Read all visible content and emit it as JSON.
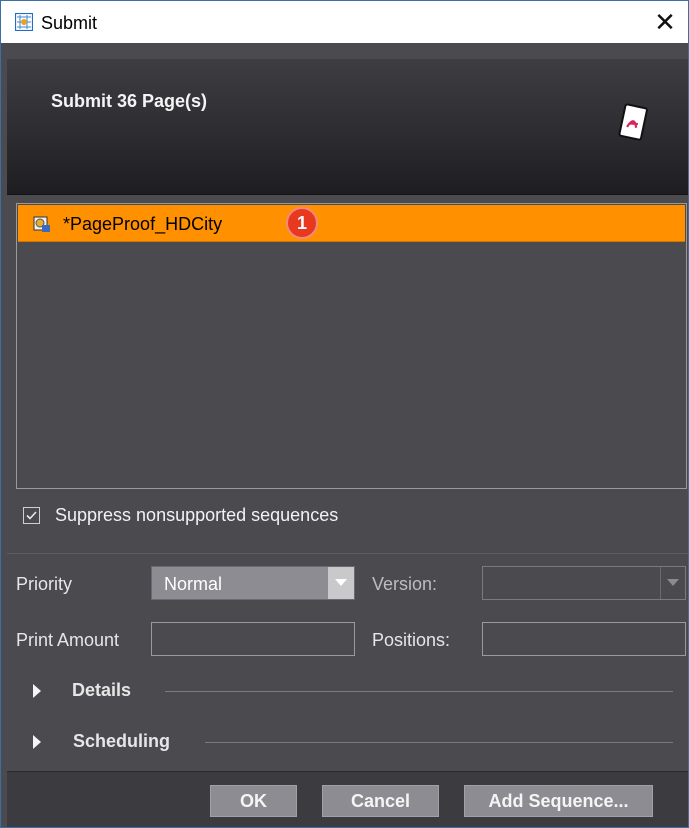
{
  "window": {
    "title": "Submit",
    "close_glyph": "✕"
  },
  "header": {
    "title": "Submit 36 Page(s)",
    "icon": "pdf-document-icon"
  },
  "sequence_list": {
    "items": [
      {
        "label": "*PageProof_HDCity",
        "icon": "sequence-icon",
        "selected": true,
        "badge": "1"
      }
    ]
  },
  "suppress": {
    "checked": true,
    "check_glyph": "✓",
    "label": "Suppress nonsupported sequences"
  },
  "form": {
    "priority_label": "Priority",
    "priority_value": "Normal",
    "version_label": "Version:",
    "version_value": "",
    "print_amount_label": "Print Amount",
    "print_amount_value": "",
    "positions_label": "Positions:",
    "positions_value": ""
  },
  "sections": [
    {
      "label": "Details",
      "expanded": false
    },
    {
      "label": "Scheduling",
      "expanded": false
    }
  ],
  "buttons": {
    "ok": "OK",
    "cancel": "Cancel",
    "add_sequence": "Add Sequence..."
  },
  "colors": {
    "accent_selected": "#ff9000",
    "badge": "#e8381f",
    "panel_bg": "#4a4a4f"
  }
}
